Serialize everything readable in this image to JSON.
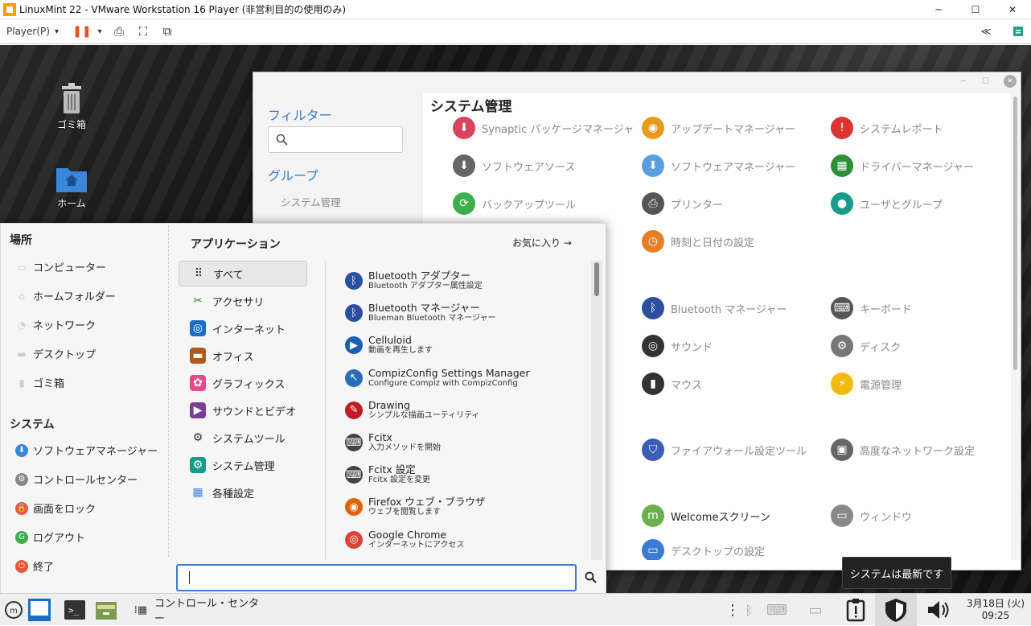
{
  "vm": {
    "title": "LinuxMint 22 - VMware Workstation 16 Player (非営利目的の使用のみ)",
    "player": "Player(P)",
    "dd": "▾",
    "pause": "❚❚",
    "send": "⎙",
    "full": "⛶",
    "unity": "⧉",
    "more": "≪",
    "min": "─",
    "max": "☐",
    "close": "✕"
  },
  "desktop": {
    "trash": "ゴミ箱",
    "home": "ホーム"
  },
  "cc": {
    "filter": "フィルター",
    "group": "グループ",
    "group_item": "システム管理",
    "title": "システム管理",
    "items": [
      {
        "label": "Synaptic パッケージマネージャ",
        "color": "#d9435e",
        "glyph": "⬇"
      },
      {
        "label": "アップデートマネージャー",
        "color": "#e69a1f",
        "glyph": "◉"
      },
      {
        "label": "システムレポート",
        "color": "#d33",
        "glyph": "!"
      },
      {
        "label": "ソフトウェアソース",
        "color": "#666",
        "glyph": "⬇"
      },
      {
        "label": "ソフトウェアマネージャー",
        "color": "#5a9de0",
        "glyph": "⬇"
      },
      {
        "label": "ドライバーマネージャー",
        "color": "#2d8f3a",
        "glyph": "▦"
      },
      {
        "label": "バックアップツール",
        "color": "#3cae4b",
        "glyph": "⟳"
      },
      {
        "label": "プリンター",
        "color": "#555",
        "glyph": "⎙"
      },
      {
        "label": "ユーザとグループ",
        "color": "#179c8a",
        "glyph": "●"
      },
      {
        "label": "時刻と日付の設定",
        "color": "#e67e22",
        "glyph": "◷"
      },
      {
        "label": "Bluetooth マネージャー",
        "color": "#2c4fa0",
        "glyph": "ᛒ"
      },
      {
        "label": "キーボード",
        "color": "#555",
        "glyph": "⌨"
      },
      {
        "label": "サウンド",
        "color": "#333",
        "glyph": "◎"
      },
      {
        "label": "ディスク",
        "color": "#777",
        "glyph": "⚙"
      },
      {
        "label": "マウス",
        "color": "#333",
        "glyph": "▮"
      },
      {
        "label": "電源管理",
        "color": "#f2b90f",
        "glyph": "⚡"
      },
      {
        "label": "ファイアウォール設定ツール",
        "color": "#3b5fb8",
        "glyph": "⛉"
      },
      {
        "label": "高度なネットワーク設定",
        "color": "#666",
        "glyph": "▣"
      },
      {
        "label": "Welcomeスクリーン",
        "color": "#6ab04c",
        "glyph": "m"
      },
      {
        "label": "ウィンドウ",
        "color": "#888",
        "glyph": "▭"
      },
      {
        "label": "デスクトップの設定",
        "color": "#3a7bd5",
        "glyph": "▭"
      }
    ]
  },
  "menu": {
    "places_h": "場所",
    "places": [
      "コンピューター",
      "ホームフォルダー",
      "ネットワーク",
      "デスクトップ",
      "ゴミ箱"
    ],
    "system_h": "システム",
    "system": [
      "ソフトウェアマネージャー",
      "コントロールセンター",
      "画面をロック",
      "ログアウト",
      "終了"
    ],
    "apps_h": "アプリケーション",
    "fav": "お気に入り →",
    "cats": [
      "すべて",
      "アクセサリ",
      "インターネット",
      "オフィス",
      "グラフィックス",
      "サウンドとビデオ",
      "システムツール",
      "システム管理",
      "各種設定"
    ],
    "apps": [
      {
        "n": "Bluetooth アダプター",
        "d": "Bluetooth アダプター属性設定",
        "c": "#2c4fa0",
        "g": "ᛒ"
      },
      {
        "n": "Bluetooth マネージャー",
        "d": "Blueman Bluetooth マネージャー",
        "c": "#2c4fa0",
        "g": "ᛒ"
      },
      {
        "n": "Celluloid",
        "d": "動画を再生します",
        "c": "#1a5fb4",
        "g": "▶"
      },
      {
        "n": "CompizConfig Settings Manager",
        "d": "Configure Compiz with CompizConfig",
        "c": "#2a6db5",
        "g": "↖"
      },
      {
        "n": "Drawing",
        "d": "シンプルな描画ユーティリティ",
        "c": "#c01c28",
        "g": "✎"
      },
      {
        "n": "Fcitx",
        "d": "入力メソッドを開始",
        "c": "#444",
        "g": "⌨"
      },
      {
        "n": "Fcitx 設定",
        "d": "Fcitx 設定を変更",
        "c": "#444",
        "g": "⌨"
      },
      {
        "n": "Firefox ウェブ・ブラウザ",
        "d": "ウェブを閲覧します",
        "c": "#e66000",
        "g": "◉"
      },
      {
        "n": "Google Chrome",
        "d": "インターネットにアクセス",
        "c": "#db4437",
        "g": "◎"
      }
    ]
  },
  "panel": {
    "task": "コントロール・センター",
    "date": "3月18日 (火)",
    "time": "09:25",
    "tooltip": "システムは最新です"
  }
}
